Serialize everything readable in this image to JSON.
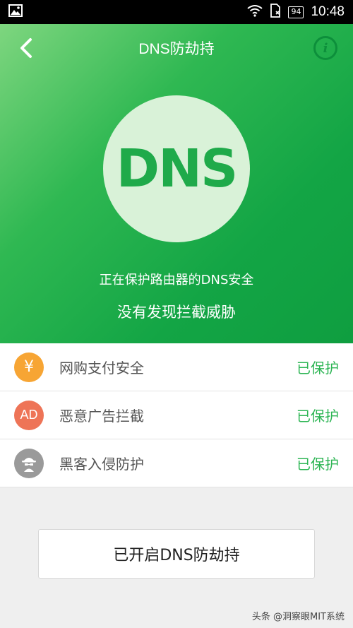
{
  "status_bar": {
    "battery": "94",
    "time": "10:48",
    "icons": [
      "image-icon",
      "wifi-icon",
      "sim-off-icon",
      "battery-icon"
    ]
  },
  "header": {
    "title": "DNS防劫持",
    "back_icon": "chevron-left-icon",
    "info_icon": "info-icon",
    "info_glyph": "i"
  },
  "hero": {
    "badge_text": "DNS",
    "status_line": "正在保护路由器的DNS安全",
    "result_line": "没有发现拦截威胁"
  },
  "features": [
    {
      "icon": "yen-icon",
      "icon_text": "¥",
      "label": "网购支付安全",
      "status": "已保护"
    },
    {
      "icon": "ad-icon",
      "icon_text": "AD",
      "label": "恶意广告拦截",
      "status": "已保护"
    },
    {
      "icon": "hacker-icon",
      "icon_text": "",
      "label": "黑客入侵防护",
      "status": "已保护"
    }
  ],
  "main_button": {
    "label": "已开启DNS防劫持"
  },
  "watermark": "头条 @洞察眼MIT系统",
  "colors": {
    "primary_green": "#13a545",
    "status_green": "#2db554",
    "yen_orange": "#f7a534",
    "ad_red": "#ee7457",
    "hacker_gray": "#9a9a9a"
  }
}
